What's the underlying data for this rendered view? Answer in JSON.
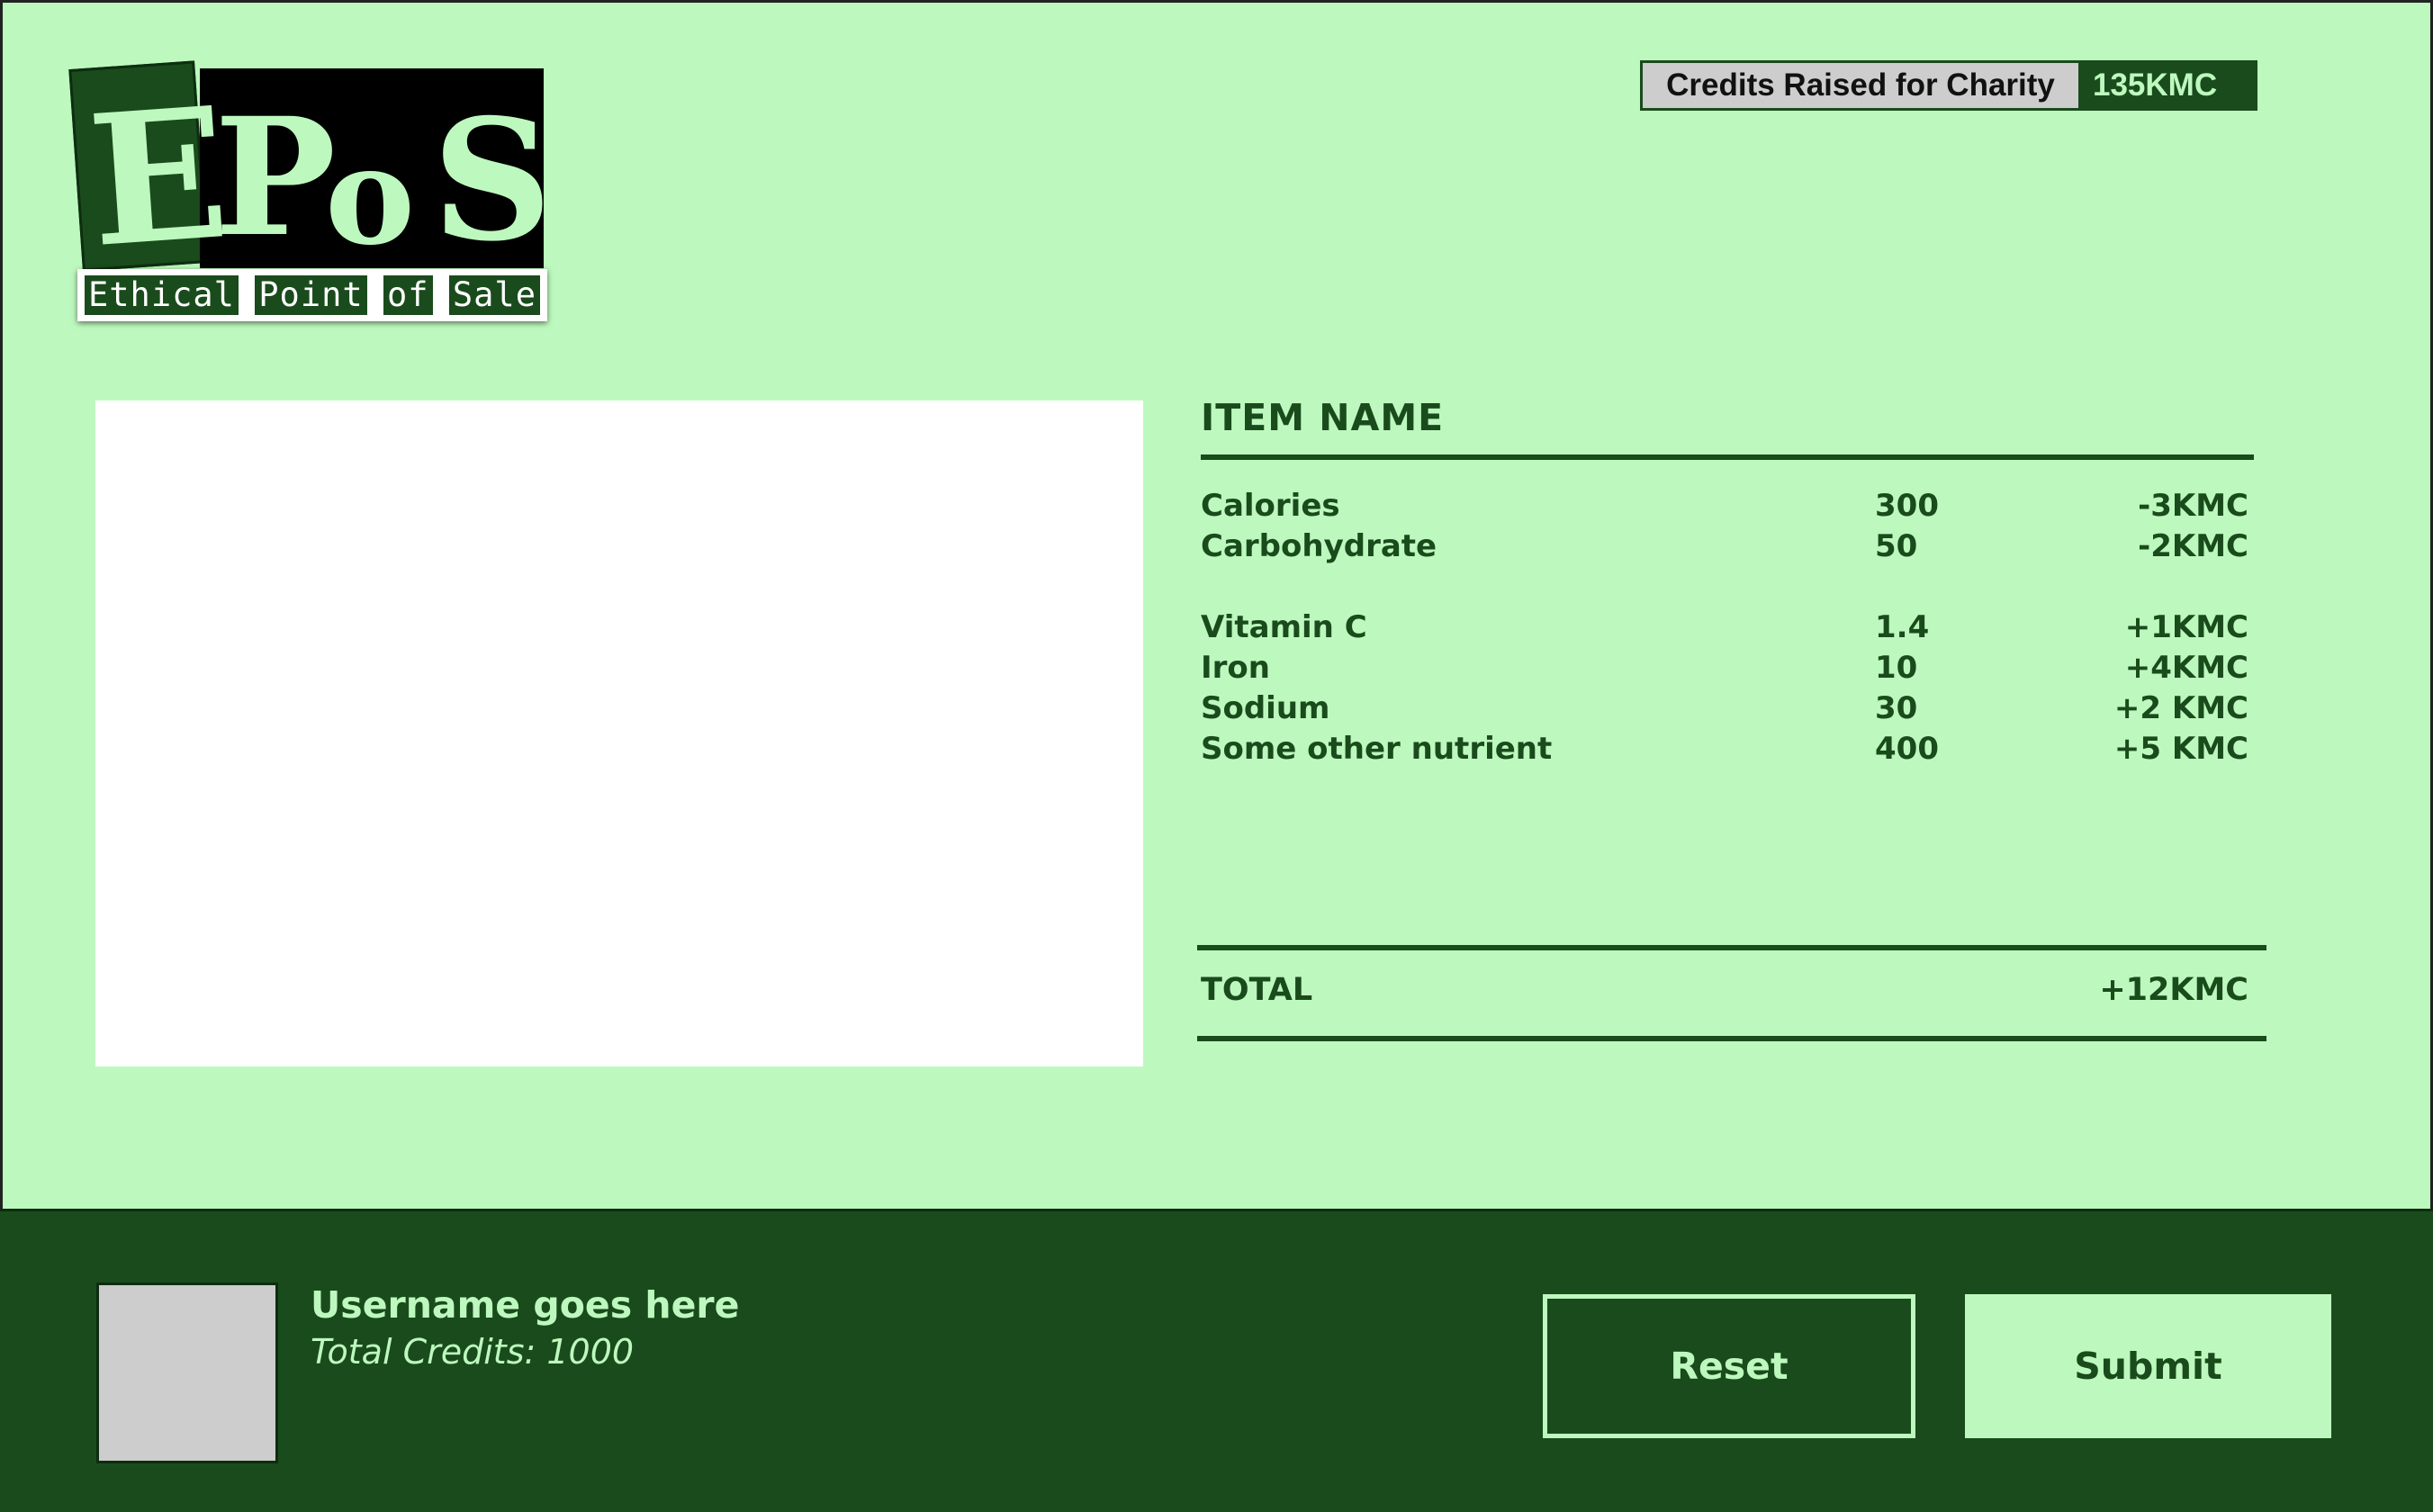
{
  "logo": {
    "letters": [
      "E",
      "P",
      "o",
      "S"
    ],
    "tagline_words": [
      "Ethical",
      "Point",
      "of",
      "Sale"
    ]
  },
  "charity": {
    "label": "Credits Raised for Charity",
    "value": "135KMC"
  },
  "item": {
    "title": "ITEM NAME",
    "nutrients": [
      {
        "name": "Calories",
        "amount": "300",
        "credit": "-3KMC"
      },
      {
        "name": "Carbohydrate",
        "amount": "50",
        "credit": "-2KMC"
      },
      {
        "name": "Vitamin C",
        "amount": "1.4",
        "credit": "+1KMC"
      },
      {
        "name": "Iron",
        "amount": "10",
        "credit": "+4KMC"
      },
      {
        "name": "Sodium",
        "amount": "30",
        "credit": "+2 KMC"
      },
      {
        "name": "Some other nutrient",
        "amount": "400",
        "credit": "+5 KMC"
      }
    ],
    "total_label": "TOTAL",
    "total_value": "+12KMC"
  },
  "user": {
    "username": "Username goes here",
    "total_credits": "Total Credits: 1000"
  },
  "actions": {
    "reset_label": "Reset",
    "submit_label": "Submit"
  },
  "colors": {
    "background": "#bdf9be",
    "primary": "#1a4b1c",
    "placeholder_gray": "#cdcdcd"
  }
}
